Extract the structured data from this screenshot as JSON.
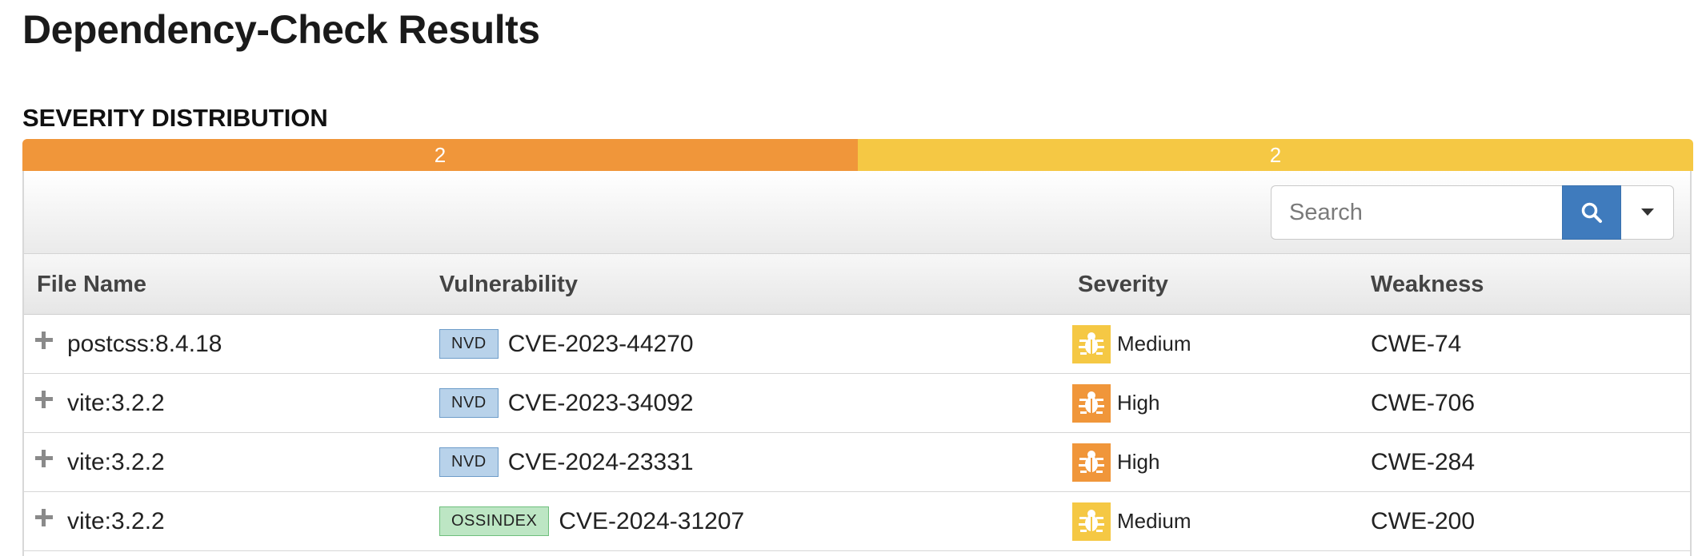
{
  "page": {
    "title": "Dependency-Check Results"
  },
  "severity_distribution": {
    "heading": "SEVERITY DISTRIBUTION",
    "segments": [
      {
        "label": "2",
        "value": 2,
        "color": "#f0963a"
      },
      {
        "label": "2",
        "value": 2,
        "color": "#f5c844"
      }
    ]
  },
  "toolbar": {
    "search_placeholder": "Search",
    "search_icon": "search-icon",
    "dropdown_icon": "caret-down-icon"
  },
  "table": {
    "columns": [
      "File Name",
      "Vulnerability",
      "Severity",
      "Weakness"
    ],
    "rows": [
      {
        "file": "postcss:8.4.18",
        "source": "NVD",
        "cve": "CVE-2023-44270",
        "severity": "Medium",
        "weakness": "CWE-74"
      },
      {
        "file": "vite:3.2.2",
        "source": "NVD",
        "cve": "CVE-2023-34092",
        "severity": "High",
        "weakness": "CWE-706"
      },
      {
        "file": "vite:3.2.2",
        "source": "NVD",
        "cve": "CVE-2024-23331",
        "severity": "High",
        "weakness": "CWE-284"
      },
      {
        "file": "vite:3.2.2",
        "source": "OSSINDEX",
        "cve": "CVE-2024-31207",
        "severity": "Medium",
        "weakness": "CWE-200"
      }
    ]
  },
  "colors": {
    "high": "#f0963a",
    "medium": "#f5c844",
    "nvd_bg": "#b8d2ea",
    "nvd_border": "#6d9cc9",
    "ossindex_bg": "#bde6c4",
    "ossindex_border": "#6ebf7c"
  }
}
